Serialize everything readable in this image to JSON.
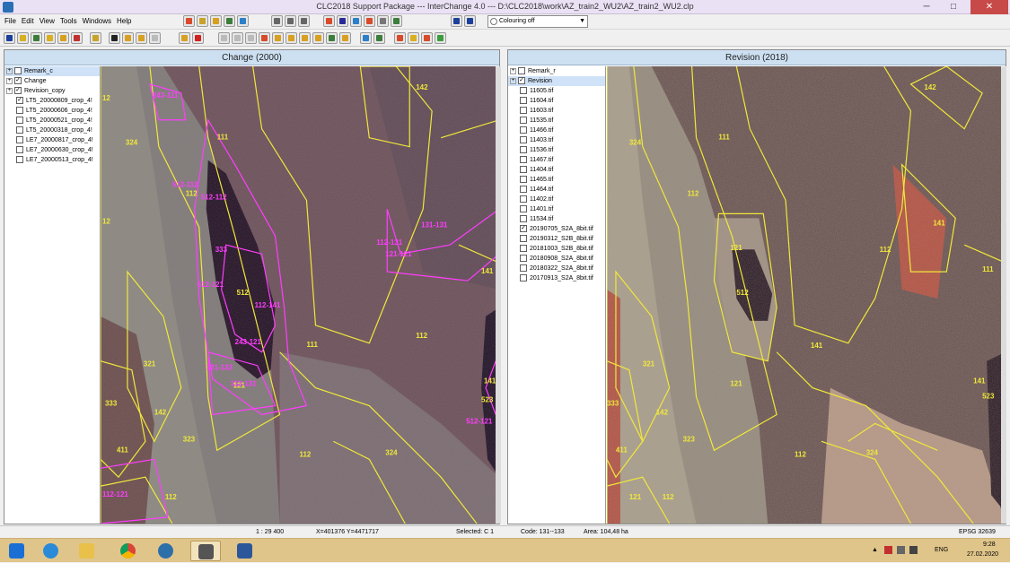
{
  "window": {
    "title": "CLC2018 Support Package --- InterChange 4.0 --- D:\\CLC2018\\work\\AZ_train2_WU2\\AZ_train2_WU2.clp",
    "minimize": "─",
    "maximize": "□",
    "close": "✕"
  },
  "menu": [
    "File",
    "Edit",
    "View",
    "Tools",
    "Windows",
    "Help"
  ],
  "toolbar": {
    "colouring_value": "Colouring off"
  },
  "left_pane": {
    "title": "Change (2000)",
    "layers": [
      {
        "label": "Remark_c",
        "checked": "",
        "expand": "+",
        "selected": true
      },
      {
        "label": "Change",
        "checked": "✓",
        "expand": "+",
        "selected": false
      },
      {
        "label": "Revision_copy",
        "checked": "✓",
        "expand": "+",
        "selected": false
      },
      {
        "label": "LT5_20000809_crop_4!",
        "checked": "✓",
        "expand": "",
        "selected": false
      },
      {
        "label": "LT5_20000606_crop_4!",
        "checked": "",
        "expand": "",
        "selected": false
      },
      {
        "label": "LT5_20000521_crop_4!",
        "checked": "",
        "expand": "",
        "selected": false
      },
      {
        "label": "LT5_20000318_crop_4!",
        "checked": "",
        "expand": "",
        "selected": false
      },
      {
        "label": "LE7_20000817_crop_4!",
        "checked": "",
        "expand": "",
        "selected": false
      },
      {
        "label": "LE7_20000630_crop_4!",
        "checked": "",
        "expand": "",
        "selected": false
      },
      {
        "label": "LE7_20000513_crop_4!",
        "checked": "",
        "expand": "",
        "selected": false
      }
    ],
    "map_labels": {
      "yellow": [
        "12",
        "324",
        "111",
        "112",
        "12",
        "142",
        "321",
        "142",
        "333",
        "323",
        "411",
        "112",
        "112",
        "141",
        "111",
        "141",
        "523",
        "121",
        "512",
        "324",
        "112"
      ],
      "magenta": [
        "243-111",
        "512-112",
        "512-112",
        "512-121",
        "243-121",
        "121-133",
        "112-131",
        "112-131",
        "121-121",
        "512-121",
        "112-141",
        "131-131",
        "333",
        "112-121"
      ]
    }
  },
  "right_pane": {
    "title": "Revision (2018)",
    "layers": [
      {
        "label": "Remark_r",
        "checked": "",
        "expand": "+",
        "selected": false
      },
      {
        "label": "Revision",
        "checked": "✓",
        "expand": "+",
        "selected": true
      },
      {
        "label": "11605.tif",
        "checked": "",
        "expand": "",
        "selected": false
      },
      {
        "label": "11604.tif",
        "checked": "",
        "expand": "",
        "selected": false
      },
      {
        "label": "11603.tif",
        "checked": "",
        "expand": "",
        "selected": false
      },
      {
        "label": "11535.tif",
        "checked": "",
        "expand": "",
        "selected": false
      },
      {
        "label": "11466.tif",
        "checked": "",
        "expand": "",
        "selected": false
      },
      {
        "label": "11403.tif",
        "checked": "",
        "expand": "",
        "selected": false
      },
      {
        "label": "11536.tif",
        "checked": "",
        "expand": "",
        "selected": false
      },
      {
        "label": "11467.tif",
        "checked": "",
        "expand": "",
        "selected": false
      },
      {
        "label": "11404.tif",
        "checked": "",
        "expand": "",
        "selected": false
      },
      {
        "label": "11465.tif",
        "checked": "",
        "expand": "",
        "selected": false
      },
      {
        "label": "11464.tif",
        "checked": "",
        "expand": "",
        "selected": false
      },
      {
        "label": "11402.tif",
        "checked": "",
        "expand": "",
        "selected": false
      },
      {
        "label": "11401.tif",
        "checked": "",
        "expand": "",
        "selected": false
      },
      {
        "label": "11534.tif",
        "checked": "",
        "expand": "",
        "selected": false
      },
      {
        "label": "20190705_S2A_8bit.tif",
        "checked": "✓",
        "expand": "",
        "selected": false
      },
      {
        "label": "20190312_S2B_8bit.tif",
        "checked": "",
        "expand": "",
        "selected": false
      },
      {
        "label": "20181003_S2B_8bit.tif",
        "checked": "",
        "expand": "",
        "selected": false
      },
      {
        "label": "20180908_S2A_8bit.tif",
        "checked": "",
        "expand": "",
        "selected": false
      },
      {
        "label": "20180322_S2A_8bit.tif",
        "checked": "",
        "expand": "",
        "selected": false
      },
      {
        "label": "20170913_S2A_8bit.tif",
        "checked": "",
        "expand": "",
        "selected": false
      }
    ],
    "map_labels": {
      "yellow": [
        "142",
        "324",
        "111",
        "112",
        "141",
        "111",
        "112",
        "121",
        "512",
        "141",
        "321",
        "121",
        "142",
        "333",
        "323",
        "411",
        "121",
        "112",
        "141",
        "523",
        "324",
        "112"
      ]
    }
  },
  "statusbar": {
    "scale": "1 : 29 400",
    "coords": "X=401376  Y=4471717",
    "selected": "Selected: C 1",
    "code": "Code: 131--133",
    "area": "Area: 104,48 ha",
    "epsg": "EPSG 32639"
  },
  "taskbar": {
    "lang": "ENG",
    "time": "9:28",
    "date": "27.02.2020"
  },
  "colors": {
    "title_bg": "#eae1f4",
    "pane_caption": "#cde0f2",
    "polygon_yellow": "#f0e83a",
    "polygon_magenta": "#ff3dff",
    "taskbar": "#e0c58a"
  }
}
